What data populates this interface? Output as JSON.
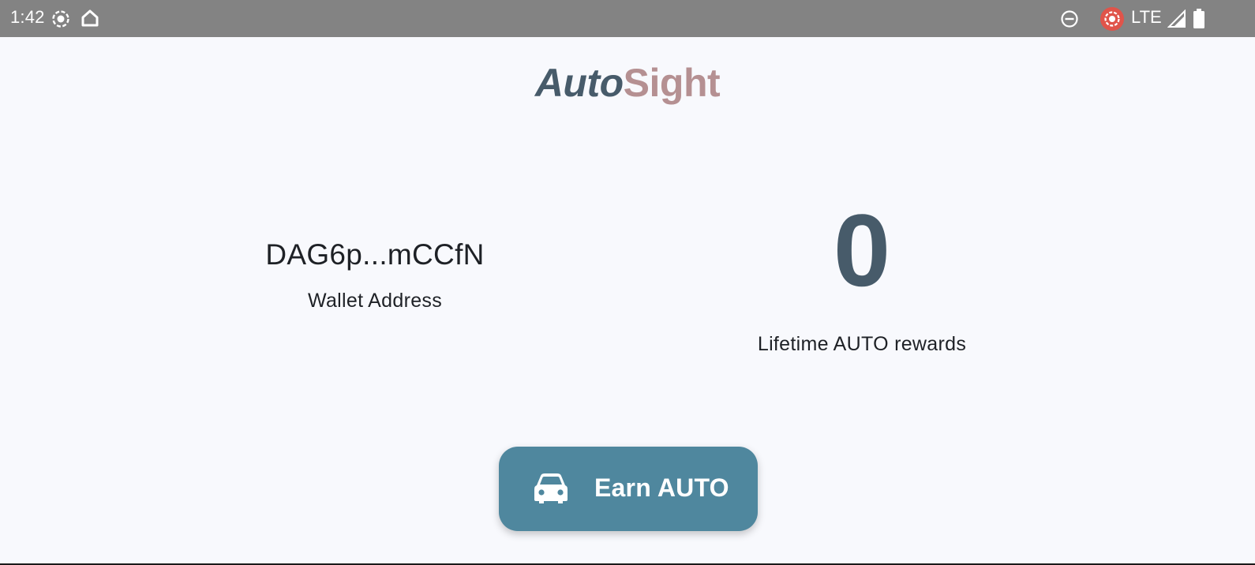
{
  "status_bar": {
    "time": "1:42",
    "network": "LTE",
    "left_icons": [
      "screen-record-icon",
      "home-icon"
    ],
    "right_icons": [
      "do-not-disturb-icon",
      "recording-indicator-icon",
      "signal-icon",
      "battery-icon"
    ]
  },
  "app": {
    "title_part1": "Auto",
    "title_part2": "Sight",
    "title_colors": {
      "part1": "#475b6a",
      "part2": "#b59092"
    }
  },
  "wallet": {
    "address": "DAG6p...mCCfN",
    "label": "Wallet Address"
  },
  "rewards": {
    "value": "0",
    "label": "Lifetime AUTO rewards"
  },
  "earn_button": {
    "label": "Earn AUTO",
    "icon": "car-icon",
    "color": "#4f879e"
  }
}
